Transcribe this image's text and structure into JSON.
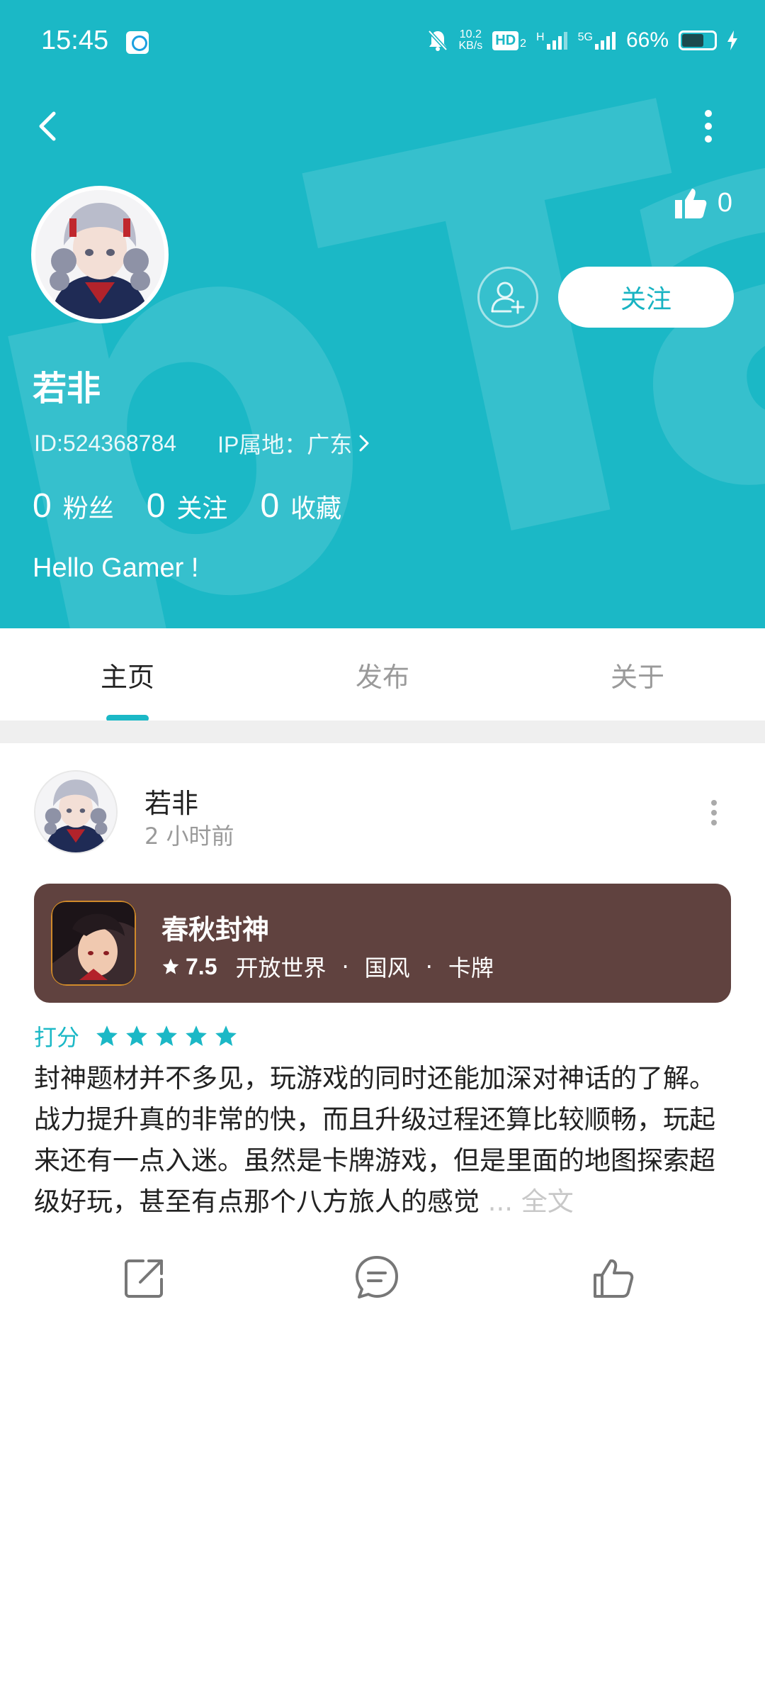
{
  "status_bar": {
    "time": "15:45",
    "net_speed_value": "10.2",
    "net_speed_unit": "KB/s",
    "hd_label": "HD",
    "hd_sub": "2",
    "network_h": "H",
    "network_5g": "5G",
    "battery": "66%"
  },
  "header": {
    "watermark": "pTap",
    "like_count": "0",
    "follow_label": "关注"
  },
  "profile": {
    "name": "若非",
    "id_text": "ID:524368784",
    "ip_text": "IP属地：广东",
    "fans_count": "0",
    "fans_label": "粉丝",
    "following_count": "0",
    "following_label": "关注",
    "favorites_count": "0",
    "favorites_label": "收藏",
    "bio": "Hello Gamer !"
  },
  "tabs": [
    {
      "label": "主页"
    },
    {
      "label": "发布"
    },
    {
      "label": "关于"
    }
  ],
  "post": {
    "author": "若非",
    "time": "2 小时前",
    "game": {
      "title": "春秋封神",
      "rating": "7.5",
      "tags": [
        "开放世界",
        "国风",
        "卡牌"
      ],
      "separator": "·"
    },
    "score_label": "打分",
    "score_stars": 5,
    "body": "封神题材并不多见，玩游戏的同时还能加深对神话的了解。战力提升真的非常的快，而且升级过程还算比较顺畅，玩起来还有一点入迷。虽然是卡牌游戏，但是里面的地图探索超级好玩，甚至有点那个八方旅人的感觉",
    "ellipsis": " ... ",
    "full_text_label": "全文"
  },
  "colors": {
    "brand": "#1bb8c6",
    "game_card": "#60423f",
    "secondary_text": "#9a9a9a"
  },
  "icons": {
    "back": "chevron-left-icon",
    "more": "more-vertical-icon",
    "like": "thumbs-up-icon",
    "add_friend": "add-user-icon",
    "share": "share-icon",
    "comment": "comment-icon",
    "star": "star-icon"
  }
}
